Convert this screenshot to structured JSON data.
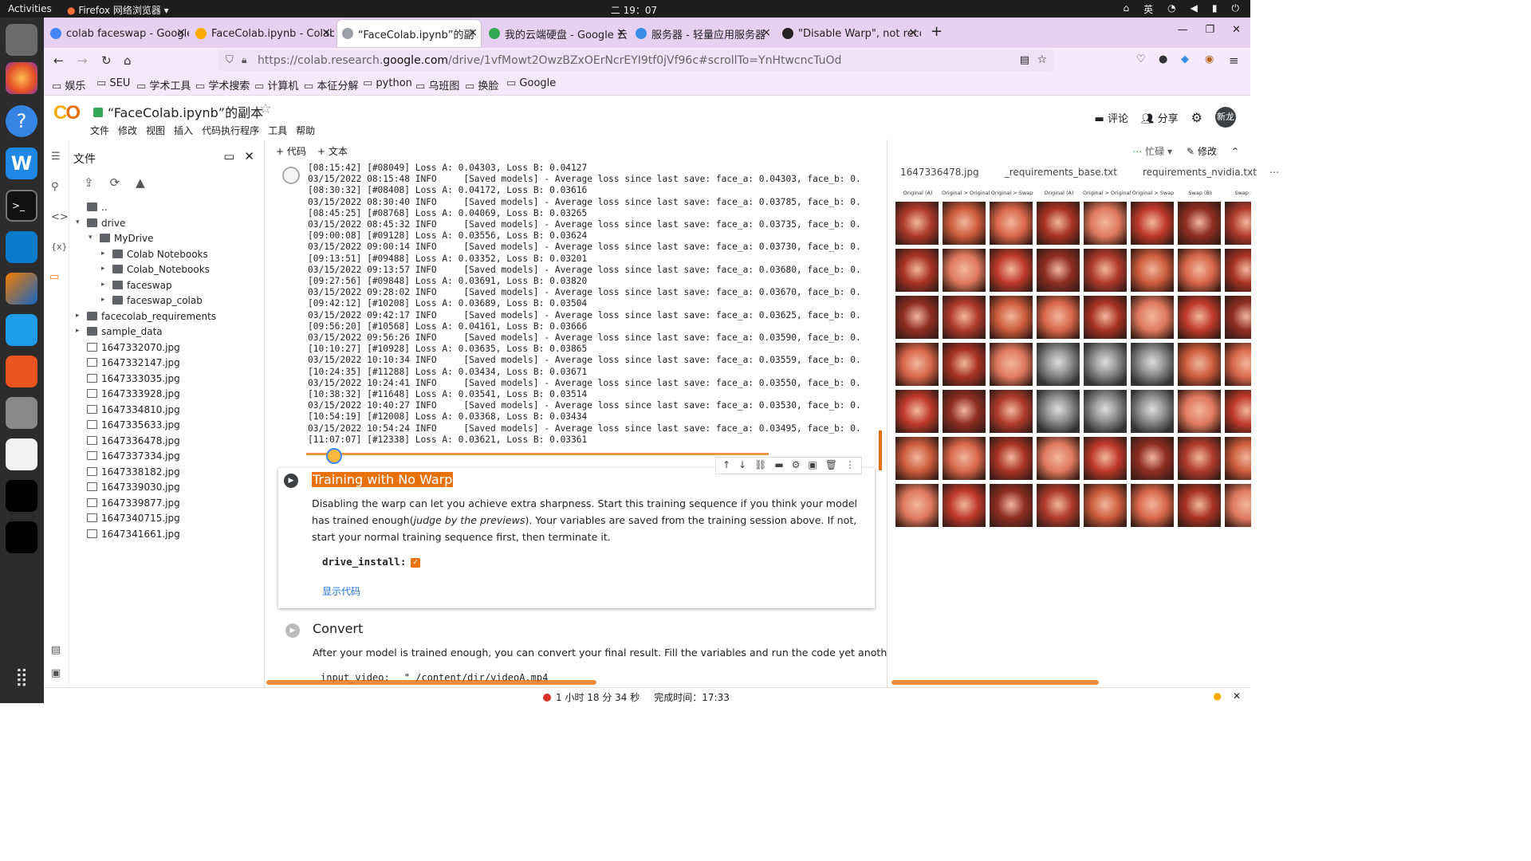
{
  "system": {
    "activities": "Activities",
    "app": "Firefox 网络浏览器",
    "clock": "二 19：07",
    "ime": "英"
  },
  "tabs": [
    {
      "label": "colab faceswap - Google",
      "x": "×"
    },
    {
      "label": "FaceColab.ipynb - Colab",
      "x": "×"
    },
    {
      "label": "“FaceColab.ipynb”的副",
      "x": "×"
    },
    {
      "label": "我的云端硬盘 - Google 云",
      "x": "×"
    },
    {
      "label": "服务器 - 轻量应用服务器",
      "x": "×"
    },
    {
      "label": "\"Disable Warp\", not reco",
      "x": "×"
    }
  ],
  "url": {
    "prefix": "https://colab.research.",
    "domain": "google.com",
    "path": "/drive/1vfMowt2OwzBZxOErNcrEYI9tf0jVf96c#scrollTo=YnHtwcncTuOd"
  },
  "bookmarks": [
    "娱乐",
    "SEU",
    "学术工具",
    "学术搜索",
    "计算机",
    "本征分解",
    "python",
    "乌班图",
    "换脸",
    "Google"
  ],
  "colab": {
    "logo_c": "C",
    "logo_o": "O",
    "title": "“FaceColab.ipynb”的副本",
    "menus": [
      "文件",
      "修改",
      "视图",
      "插入",
      "代码执行程序",
      "工具",
      "帮助"
    ],
    "comment": "评论",
    "share": "分享",
    "avatar": "新龙"
  },
  "files": {
    "title": "文件",
    "tree": [
      {
        "label": "..",
        "type": "folder-up",
        "depth": 0
      },
      {
        "label": "drive",
        "type": "folder",
        "depth": 0,
        "arrow": "▾"
      },
      {
        "label": "MyDrive",
        "type": "folder",
        "depth": 1,
        "arrow": "▾"
      },
      {
        "label": "Colab Notebooks",
        "type": "folder",
        "depth": 2,
        "arrow": "▸"
      },
      {
        "label": "Colab_Notebooks",
        "type": "folder",
        "depth": 2,
        "arrow": "▸"
      },
      {
        "label": "faceswap",
        "type": "folder",
        "depth": 2,
        "arrow": "▸"
      },
      {
        "label": "faceswap_colab",
        "type": "folder",
        "depth": 2,
        "arrow": "▸"
      },
      {
        "label": "facecolab_requirements",
        "type": "folder",
        "depth": 0,
        "arrow": "▸"
      },
      {
        "label": "sample_data",
        "type": "folder",
        "depth": 0,
        "arrow": "▸"
      },
      {
        "label": "1647332070.jpg",
        "type": "file",
        "depth": 0
      },
      {
        "label": "1647332147.jpg",
        "type": "file",
        "depth": 0
      },
      {
        "label": "1647333035.jpg",
        "type": "file",
        "depth": 0
      },
      {
        "label": "1647333928.jpg",
        "type": "file",
        "depth": 0
      },
      {
        "label": "1647334810.jpg",
        "type": "file",
        "depth": 0
      },
      {
        "label": "1647335633.jpg",
        "type": "file",
        "depth": 0
      },
      {
        "label": "1647336478.jpg",
        "type": "file",
        "depth": 0
      },
      {
        "label": "1647337334.jpg",
        "type": "file",
        "depth": 0
      },
      {
        "label": "1647338182.jpg",
        "type": "file",
        "depth": 0
      },
      {
        "label": "1647339030.jpg",
        "type": "file",
        "depth": 0
      },
      {
        "label": "1647339877.jpg",
        "type": "file",
        "depth": 0
      },
      {
        "label": "1647340715.jpg",
        "type": "file",
        "depth": 0
      },
      {
        "label": "1647341661.jpg",
        "type": "file",
        "depth": 0
      }
    ]
  },
  "toolbar": {
    "add_code": "+ 代码",
    "add_text": "+ 文本",
    "busy": "忙碌",
    "edit": "修改"
  },
  "output_lines": [
    "[08:15:42] [#08049] Loss A: 0.04303, Loss B: 0.04127",
    "03/15/2022 08:15:48 INFO     [Saved models] - Average loss since last save: face_a: 0.04303, face_b: 0.",
    "[08:30:32] [#08408] Loss A: 0.04172, Loss B: 0.03616",
    "03/15/2022 08:30:40 INFO     [Saved models] - Average loss since last save: face_a: 0.03785, face_b: 0.",
    "[08:45:25] [#08768] Loss A: 0.04069, Loss B: 0.03265",
    "03/15/2022 08:45:32 INFO     [Saved models] - Average loss since last save: face_a: 0.03735, face_b: 0.",
    "[09:00:08] [#09128] Loss A: 0.03556, Loss B: 0.03624",
    "03/15/2022 09:00:14 INFO     [Saved models] - Average loss since last save: face_a: 0.03730, face_b: 0.",
    "[09:13:51] [#09488] Loss A: 0.03352, Loss B: 0.03201",
    "03/15/2022 09:13:57 INFO     [Saved models] - Average loss since last save: face_a: 0.03680, face_b: 0.",
    "[09:27:56] [#09848] Loss A: 0.03691, Loss B: 0.03820",
    "03/15/2022 09:28:02 INFO     [Saved models] - Average loss since last save: face_a: 0.03670, face_b: 0.",
    "[09:42:12] [#10208] Loss A: 0.03689, Loss B: 0.03504",
    "03/15/2022 09:42:17 INFO     [Saved models] - Average loss since last save: face_a: 0.03625, face_b: 0.",
    "[09:56:20] [#10568] Loss A: 0.04161, Loss B: 0.03666",
    "03/15/2022 09:56:26 INFO     [Saved models] - Average loss since last save: face_a: 0.03590, face_b: 0.",
    "[10:10:27] [#10928] Loss A: 0.03635, Loss B: 0.03865",
    "03/15/2022 10:10:34 INFO     [Saved models] - Average loss since last save: face_a: 0.03559, face_b: 0.",
    "[10:24:35] [#11288] Loss A: 0.03434, Loss B: 0.03671",
    "03/15/2022 10:24:41 INFO     [Saved models] - Average loss since last save: face_a: 0.03550, face_b: 0.",
    "[10:38:32] [#11648] Loss A: 0.03541, Loss B: 0.03514",
    "03/15/2022 10:40:27 INFO     [Saved models] - Average loss since last save: face_a: 0.03530, face_b: 0.",
    "[10:54:19] [#12008] Loss A: 0.03368, Loss B: 0.03434",
    "03/15/2022 10:54:24 INFO     [Saved models] - Average loss since last save: face_a: 0.03495, face_b: 0.",
    "[11:07:07] [#12338] Loss A: 0.03621, Loss B: 0.03361"
  ],
  "cell": {
    "title": "Training with No Warp",
    "text_1": "Disabling the warp can let you achieve extra sharpness. Start this training sequence if you think your model has trained enough(",
    "text_em": "judge by the previews",
    "text_2": "). Your variables are saved from the training session above. If not, start your normal training sequence first, then terminate it.",
    "param": "drive_install:",
    "show_code": "显示代码"
  },
  "convert": {
    "title": "Convert",
    "text": "After your model is trained enough, you can convert your final result. Fill the variables and run the code yet another time.",
    "param": "input_video:",
    "param_value": "\" /content/dir/videoA.mp4"
  },
  "right_panel": {
    "tabs": [
      "1647336478.jpg",
      "_requirements_base.txt",
      "requirements_nvidia.txt"
    ],
    "headers": [
      "Original (A)",
      "Original > Original",
      "Original > Swap",
      "Original (A)",
      "Original > Original",
      "Original > Swap",
      "Swap (B)",
      "Swap > S"
    ]
  },
  "status": {
    "elapsed": "1 小时 18 分 34 秒",
    "done": "完成时间：17:33"
  }
}
